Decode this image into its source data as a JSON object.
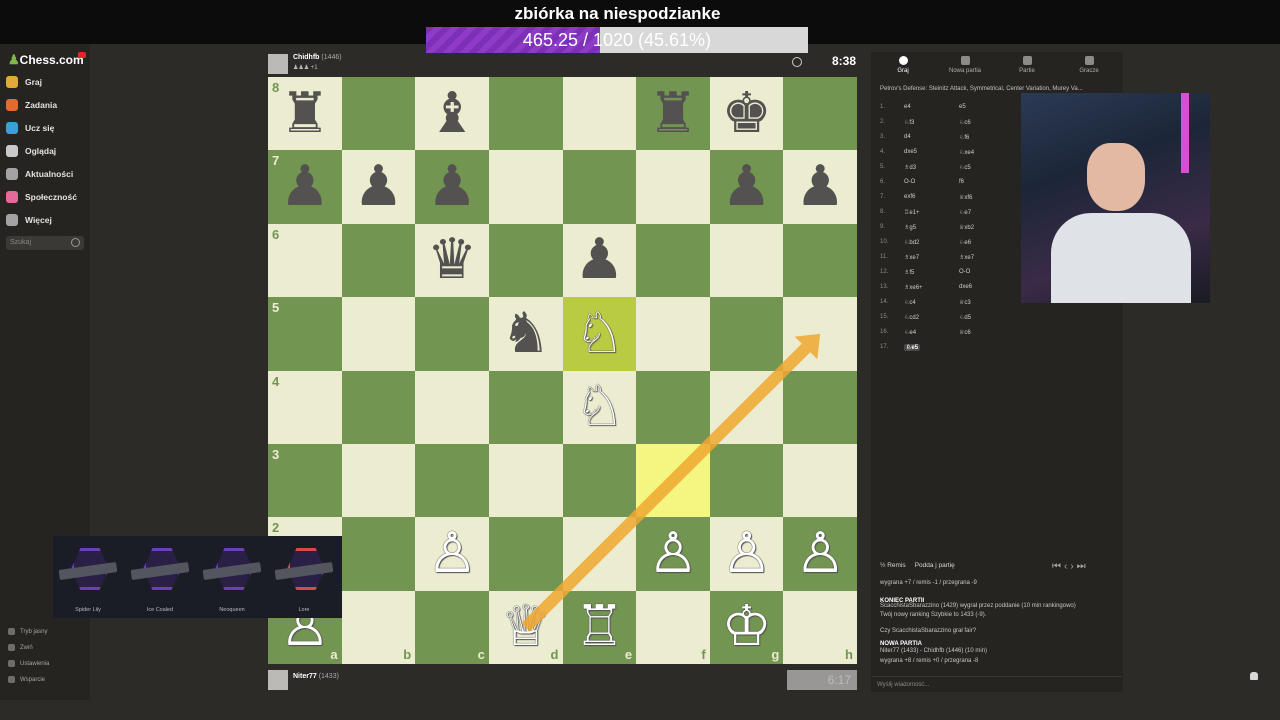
{
  "stream": {
    "title": "zbiórka na niespodzianke",
    "goal_text": "465.25 / 1020 (45.61%)",
    "goal_percent": 45.61,
    "goal_color": "#8e3cc8"
  },
  "sidebar": {
    "logo": "Chess.com",
    "items": [
      {
        "label": "Graj",
        "icon": "play-icon",
        "color": "#e0a93a"
      },
      {
        "label": "Zadania",
        "icon": "puzzle-icon",
        "color": "#e46a2d"
      },
      {
        "label": "Ucz się",
        "icon": "learn-icon",
        "color": "#3aa0d8"
      },
      {
        "label": "Oglądaj",
        "icon": "watch-icon",
        "color": "#c9c9c9"
      },
      {
        "label": "Aktualności",
        "icon": "news-icon",
        "color": "#a3a3a3"
      },
      {
        "label": "Społeczność",
        "icon": "community-icon",
        "color": "#e46a9a"
      },
      {
        "label": "Więcej",
        "icon": "more-icon",
        "color": "#a3a3a3"
      }
    ],
    "search_placeholder": "Szukaj",
    "bottom": [
      {
        "label": "Tryb jasny",
        "icon": "theme-icon"
      },
      {
        "label": "Zwiń",
        "icon": "collapse-icon"
      },
      {
        "label": "Ustawienia",
        "icon": "settings-icon"
      },
      {
        "label": "Wsparcie",
        "icon": "help-icon"
      }
    ]
  },
  "top_player": {
    "name": "Chidhfb",
    "rating": "(1446)",
    "captured": "♟♟♟ +1",
    "clock": "8:38"
  },
  "bottom_player": {
    "name": "Niter77",
    "rating": "(1433)",
    "clock": "6:17"
  },
  "board": {
    "files": [
      "a",
      "b",
      "c",
      "d",
      "e",
      "f",
      "g",
      "h"
    ],
    "ranks": [
      "8",
      "7",
      "6",
      "5",
      "4",
      "3",
      "2",
      "1"
    ],
    "light_color": "#ebecd0",
    "dark_color": "#739552",
    "highlights": [
      "f3",
      "e5"
    ],
    "arrow": {
      "from": "d1",
      "to": "h5",
      "color": "#f0a830"
    },
    "pieces": [
      {
        "sq": "a8",
        "color": "black",
        "glyph": "♜"
      },
      {
        "sq": "c8",
        "color": "black",
        "glyph": "♝"
      },
      {
        "sq": "f8",
        "color": "black",
        "glyph": "♜"
      },
      {
        "sq": "g8",
        "color": "black",
        "glyph": "♚"
      },
      {
        "sq": "a7",
        "color": "black",
        "glyph": "♟"
      },
      {
        "sq": "b7",
        "color": "black",
        "glyph": "♟"
      },
      {
        "sq": "c7",
        "color": "black",
        "glyph": "♟"
      },
      {
        "sq": "g7",
        "color": "black",
        "glyph": "♟"
      },
      {
        "sq": "h7",
        "color": "black",
        "glyph": "♟"
      },
      {
        "sq": "c6",
        "color": "black",
        "glyph": "♛"
      },
      {
        "sq": "e6",
        "color": "black",
        "glyph": "♟"
      },
      {
        "sq": "d5",
        "color": "black",
        "glyph": "♞"
      },
      {
        "sq": "e5",
        "color": "white",
        "glyph": "♘"
      },
      {
        "sq": "e4",
        "color": "white",
        "glyph": "♘"
      },
      {
        "sq": "c2",
        "color": "white",
        "glyph": "♙"
      },
      {
        "sq": "f2",
        "color": "white",
        "glyph": "♙"
      },
      {
        "sq": "g2",
        "color": "white",
        "glyph": "♙"
      },
      {
        "sq": "h2",
        "color": "white",
        "glyph": "♙"
      },
      {
        "sq": "a1",
        "color": "white",
        "glyph": "♙"
      },
      {
        "sq": "d1",
        "color": "white",
        "glyph": "♕"
      },
      {
        "sq": "e1",
        "color": "white",
        "glyph": "♖"
      },
      {
        "sq": "g1",
        "color": "white",
        "glyph": "♔"
      }
    ]
  },
  "skins": [
    {
      "label": "Spider Lily",
      "color": "#6a3fb8"
    },
    {
      "label": "Ice Coaled",
      "color": "#6a3fb8"
    },
    {
      "label": "Neoqueen",
      "color": "#6a3fb8"
    },
    {
      "label": "Lore",
      "color": "#d84a4a"
    }
  ],
  "panel": {
    "tabs": [
      {
        "label": "Graj",
        "icon": "clock-icon"
      },
      {
        "label": "Nowa partia",
        "icon": "plus-icon"
      },
      {
        "label": "Partie",
        "icon": "grid-icon"
      },
      {
        "label": "Gracze",
        "icon": "players-icon"
      }
    ],
    "opening": "Petrov's Defense: Steinitz Attack, Symmetrical, Center Variation, Murey Va...",
    "moves": [
      {
        "n": "1.",
        "w": "e4",
        "b": "e5"
      },
      {
        "n": "2.",
        "w": "♘f3",
        "b": "♘c6"
      },
      {
        "n": "3.",
        "w": "d4",
        "b": "♘f6"
      },
      {
        "n": "4.",
        "w": "dxe5",
        "b": "♘xe4"
      },
      {
        "n": "5.",
        "w": "♗d3",
        "b": "♘c5"
      },
      {
        "n": "6.",
        "w": "O-O",
        "b": "f6"
      },
      {
        "n": "7.",
        "w": "exf6",
        "b": "♕xf6"
      },
      {
        "n": "8.",
        "w": "♖e1+",
        "b": "♘e7"
      },
      {
        "n": "9.",
        "w": "♗g5",
        "b": "♕xb2"
      },
      {
        "n": "10.",
        "w": "♘bd2",
        "b": "♘e6"
      },
      {
        "n": "11.",
        "w": "♗xe7",
        "b": "♗xe7"
      },
      {
        "n": "12.",
        "w": "♗f5",
        "b": "O-O"
      },
      {
        "n": "13.",
        "w": "♗xe6+",
        "b": "dxe6"
      },
      {
        "n": "14.",
        "w": "♘c4",
        "b": "♕c3"
      },
      {
        "n": "15.",
        "w": "♘cd2",
        "b": "♘d5"
      },
      {
        "n": "16.",
        "w": "♘e4",
        "b": "♕c6"
      },
      {
        "n": "17.",
        "w": "♘e5",
        "b": ""
      }
    ],
    "actions": {
      "draw": "½ Remis",
      "resign": "Podda j partię"
    },
    "chat": [
      {
        "text": "wygrana +7 / remis -1 / przegrana -9",
        "bold": false
      },
      {
        "text": "KONIEC PARTII",
        "bold": true
      },
      {
        "text": "ScacchistaSbarazzino (1429) wygrał przez poddanie (10 min rankingowo)",
        "bold": false
      },
      {
        "text": "Twój nowy ranking Szybkie to 1433 (-9).",
        "bold": false
      },
      {
        "text": "Czy ScacchistaSbarazzino grał fair?",
        "bold": false
      },
      {
        "text": "NOWA PARTIA",
        "bold": true
      },
      {
        "text": "Niter77 (1433) - Chidhfb (1446) (10 min)",
        "bold": false
      },
      {
        "text": "wygrana +8 / remis +0 / przegrana -8",
        "bold": false
      }
    ],
    "chat_placeholder": "Wyślij wiadomość..."
  }
}
